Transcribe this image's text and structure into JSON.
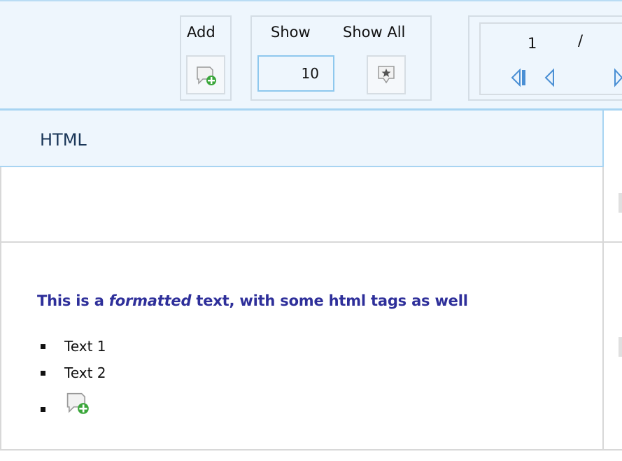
{
  "toolbar": {
    "add_label": "Add",
    "add_icon": "add-comment-icon",
    "show_label": "Show",
    "show_value": "10",
    "show_all_label": "Show All",
    "show_all_icon": "star-icon"
  },
  "pager": {
    "current_page": "1",
    "separator": "/",
    "first_icon": "first-page-icon",
    "prev_icon": "previous-page-icon",
    "next_icon": "next-page-icon"
  },
  "grid": {
    "column_header": "HTML",
    "formatted_text": {
      "before": "This is a ",
      "emphasis": "formatted",
      "after": " text, with some html tags as well"
    },
    "list_items": [
      "Text 1",
      "Text 2"
    ],
    "list_icon": "add-comment-icon"
  },
  "colors": {
    "toolbar_bg": "#eef6fd",
    "accent_border": "#a8d4f2",
    "nav_blue": "#4a8fd4",
    "formatted_text": "#2e2f9a"
  }
}
